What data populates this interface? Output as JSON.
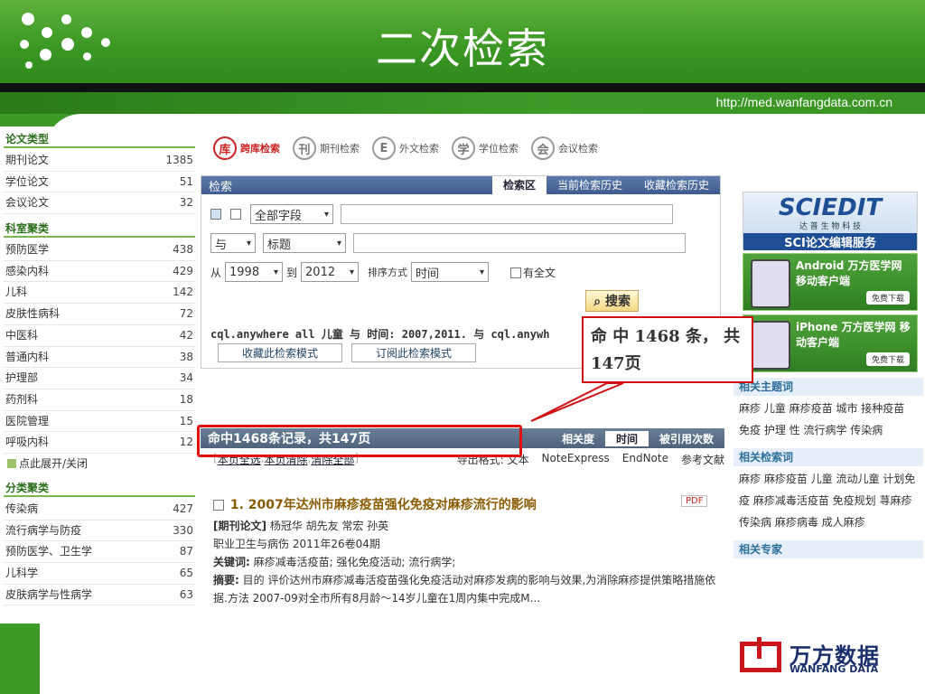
{
  "slide": {
    "title": "二次检索",
    "url": "http://med.wanfangdata.com.cn"
  },
  "sidebar": {
    "type_header": "论文类型",
    "types": [
      {
        "label": "期刊论文",
        "count": "1385"
      },
      {
        "label": "学位论文",
        "count": "51"
      },
      {
        "label": "会议论文",
        "count": "32"
      }
    ],
    "dept_header": "科室聚类",
    "depts": [
      {
        "label": "预防医学",
        "count": "438"
      },
      {
        "label": "感染内科",
        "count": "429"
      },
      {
        "label": "儿科",
        "count": "142"
      },
      {
        "label": "皮肤性病科",
        "count": "72"
      },
      {
        "label": "中医科",
        "count": "42"
      },
      {
        "label": "普通内科",
        "count": "38"
      },
      {
        "label": "护理部",
        "count": "34"
      },
      {
        "label": "药剂科",
        "count": "18"
      },
      {
        "label": "医院管理",
        "count": "15"
      },
      {
        "label": "呼吸内科",
        "count": "12"
      }
    ],
    "toggle": "点此展开/关闭",
    "class_header": "分类聚类",
    "classes": [
      {
        "label": "传染病",
        "count": "427"
      },
      {
        "label": "流行病学与防疫",
        "count": "330"
      },
      {
        "label": "预防医学、卫生学",
        "count": "87"
      },
      {
        "label": "儿科学",
        "count": "65"
      },
      {
        "label": "皮肤病学与性病学",
        "count": "63"
      }
    ]
  },
  "tabs": [
    {
      "icon": "库",
      "label": "跨库检索",
      "active": true
    },
    {
      "icon": "刊",
      "label": "期刊检索"
    },
    {
      "icon": "E",
      "label": "外文检索"
    },
    {
      "icon": "学",
      "label": "学位检索"
    },
    {
      "icon": "会",
      "label": "会议检索"
    }
  ],
  "search": {
    "box_label": "检索",
    "top_tabs": [
      "检索区",
      "当前检索历史",
      "收藏检索历史"
    ],
    "field1": "全部字段",
    "op": "与",
    "field2": "标题",
    "from_label": "从",
    "year_from": "1998",
    "to_label": "到",
    "year_to": "2012",
    "sort_label": "排序方式",
    "sort_value": "时间",
    "fulltext_label": "有全文",
    "button": "搜索",
    "cql": "cql.anywhere all 儿童 与 时间: 2007,2011. 与 cql.anywh",
    "save_mode": "收藏此检索模式",
    "subscribe_mode": "订阅此检索模式"
  },
  "results": {
    "summary": "命中1468条记录，共147页",
    "sorts": [
      "相关度",
      "时间",
      "被引用次数"
    ],
    "select_page": "本页全选",
    "clear_page": "本页清除",
    "clear_all": "清除全部",
    "export_label": "导出格式: 文本",
    "export_ne": "NoteExpress",
    "export_en": "EndNote",
    "export_ref": "参考文献",
    "record": {
      "title": "1. 2007年达州市麻疹疫苗强化免疫对麻疹流行的影响",
      "pdf": "PDF",
      "type": "[期刊论文]",
      "authors": "杨冠华 胡先友 常宏 孙英",
      "source": "职业卫生与病伤 2011年26卷04期",
      "kw_label": "关键词:",
      "keywords": "麻疹减毒活疫苗; 强化免疫活动; 流行病学;",
      "abs_label": "摘要:",
      "abstract": "目的 评价达州市麻疹减毒活疫苗强化免疫活动对麻疹发病的影响与效果,为消除麻疹提供策略措施依据.方法 2007-09对全市所有8月龄～14岁儿童在1周内集中完成M..."
    }
  },
  "right": {
    "ad_big": "SCIEDIT",
    "ad_small": "达 普 生 物 科 技",
    "ad_bottom": "SCI论文编辑服务",
    "app1": "Android 万方医学网 移动客户端",
    "app2": "iPhone 万方医学网 移动客户端",
    "download": "免费下载",
    "topics_header": "相关主题词",
    "topics": "麻疹 儿童 麻疹疫苗 城市 接种疫苗 免疫 护理 性 流行病学 传染病",
    "terms_header": "相关检索词",
    "terms": "麻疹 麻疹疫苗 儿童 流动儿童 计划免疫 麻疹减毒活疫苗 免疫规划 荨麻疹 传染病 麻疹病毒 成人麻疹",
    "experts_header": "相关专家"
  },
  "callout": "命 中 1468 条， 共147页",
  "logo": {
    "cn": "万方数据",
    "en": "WANFANG DATA"
  }
}
